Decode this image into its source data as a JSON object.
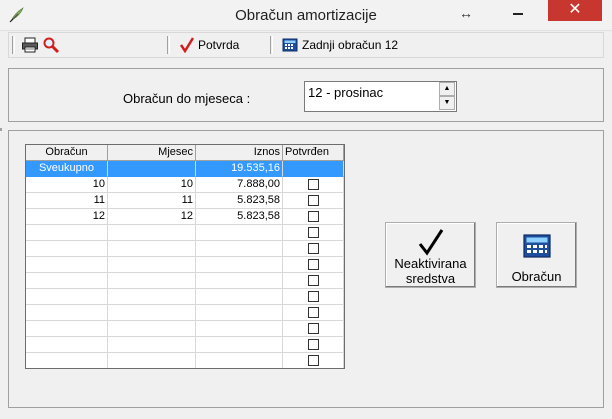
{
  "window": {
    "title": "Obračun amortizacije",
    "resize_glyph": "↔",
    "close_glyph": "✕"
  },
  "toolbar": {
    "confirm_label": "Potvrda",
    "last_calc_label": "Zadnji obračun 12"
  },
  "form": {
    "month_label": "Obračun do mjeseca :",
    "month_value": "12 - prosinac"
  },
  "grid": {
    "columns": [
      "Obračun",
      "Mjesec",
      "Iznos",
      "Potvrđen"
    ],
    "rows": [
      {
        "obracun": "Sveukupno",
        "mjesec": "",
        "iznos": "19.535,16",
        "potvrden": null
      },
      {
        "obracun": "10",
        "mjesec": "10",
        "iznos": "7.888,00",
        "potvrden": false
      },
      {
        "obracun": "11",
        "mjesec": "11",
        "iznos": "5.823,58",
        "potvrden": false
      },
      {
        "obracun": "12",
        "mjesec": "12",
        "iznos": "5.823,58",
        "potvrden": false
      }
    ]
  },
  "buttons": {
    "neaktivirana_line1": "Neaktivirana",
    "neaktivirana_line2": "sredstva",
    "obracun": "Obračun"
  },
  "icons": {
    "app": "feather-icon",
    "print": "printer-icon",
    "search": "magnifier-icon",
    "confirm": "checkmark-icon",
    "calculator": "calculator-icon"
  }
}
